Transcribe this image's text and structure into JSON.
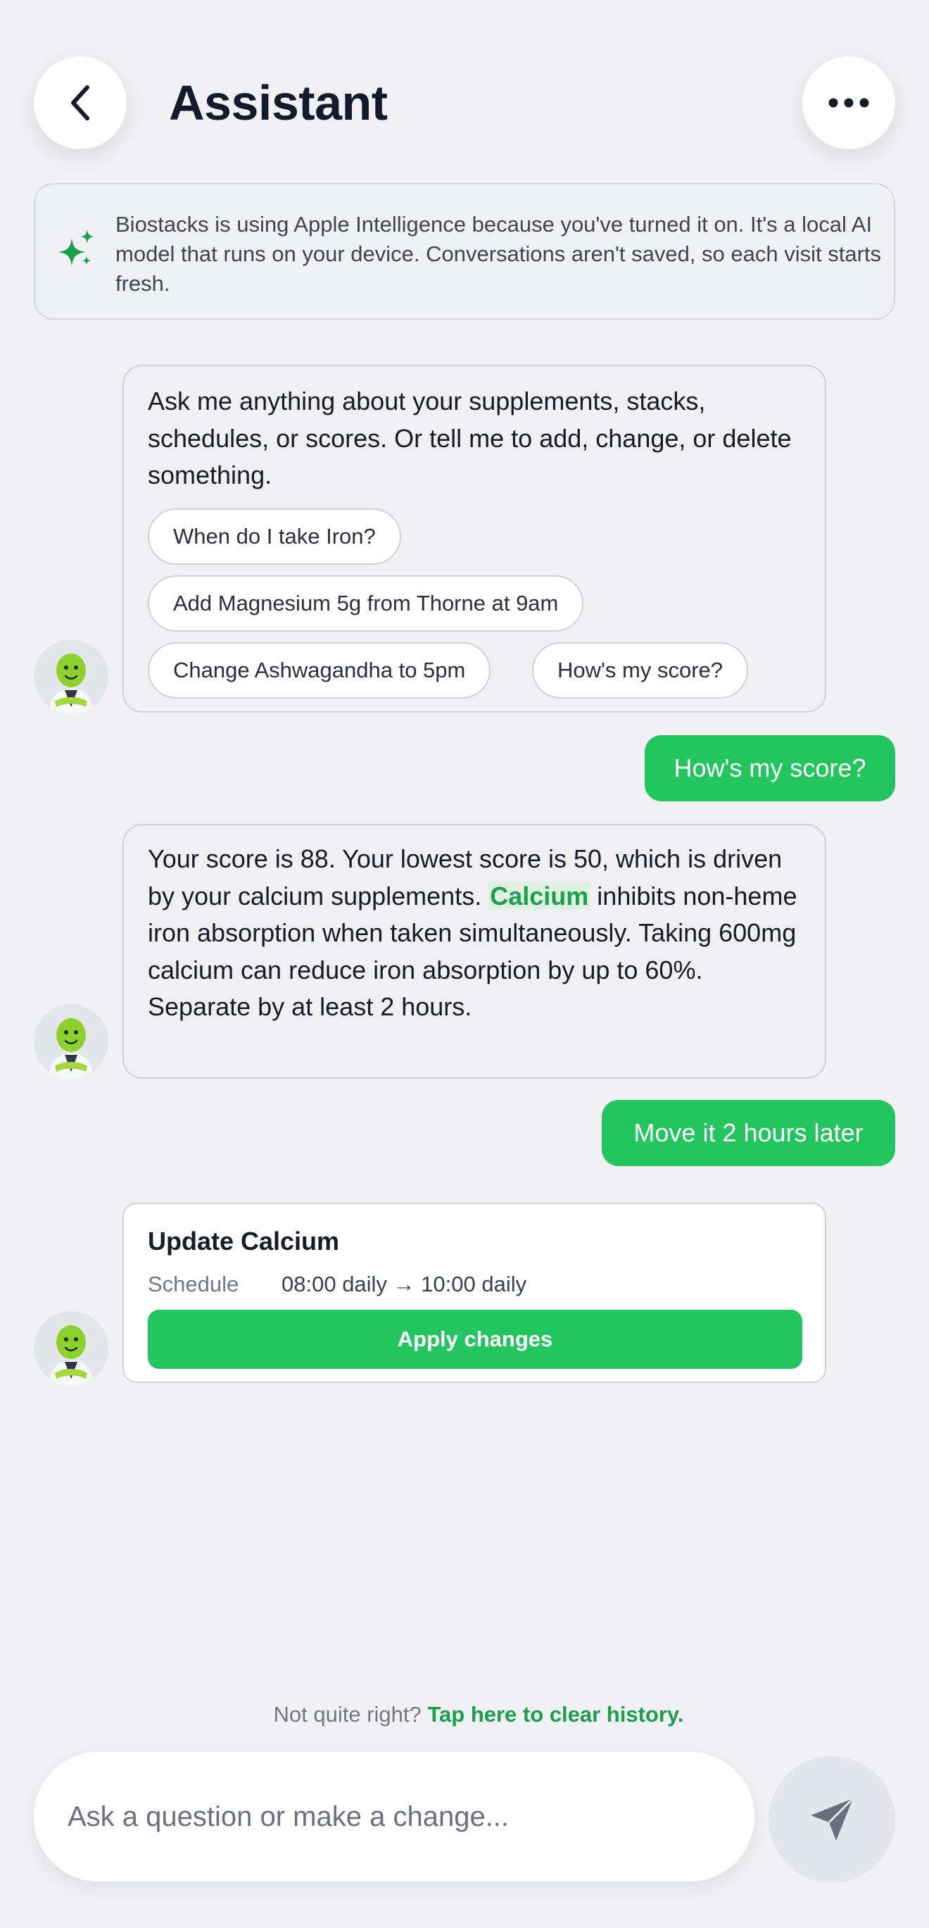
{
  "header": {
    "back_icon": "chevron-left-icon",
    "title": "Assistant",
    "more_icon": "ellipsis-icon"
  },
  "notice": {
    "icon": "sparkles-icon",
    "text": "Biostacks is using Apple Intelligence because you've turned it on. It's a local AI model that runs on your device. Conversations aren't saved, so each visit starts fresh."
  },
  "messages": {
    "intro": {
      "text": "Ask me anything about your supplements, stacks, schedules, or scores. Or tell me to add, change, or delete something.",
      "suggestions": [
        "When do I take Iron?",
        "Add Magnesium 5g from Thorne at 9am",
        "Change Ashwagandha to 5pm",
        "How's my score?"
      ]
    },
    "user_1": "How's my score?",
    "answer": {
      "before": "Your score is 88. Your lowest score is 50, which is driven by your calcium supplements.",
      "highlight": "Calcium",
      "after": "inhibits non-heme iron absorption when taken simultaneously. Taking 600mg calcium can reduce iron absorption by up to 60%. Separate by at least 2 hours."
    },
    "user_2": "Move it 2 hours later",
    "action_card": {
      "title": "Update Calcium",
      "field_label": "Schedule",
      "change": "08:00 daily → 10:00 daily",
      "button": "Apply changes"
    }
  },
  "footer": {
    "clear_prefix": "Not quite right?",
    "clear_link": "Tap here to clear history.",
    "input_placeholder": "Ask a question or make a change...",
    "send_icon": "send-icon"
  },
  "colors": {
    "accent": "#22c55e",
    "link": "#1aa04a",
    "background": "#f0f0f5"
  }
}
